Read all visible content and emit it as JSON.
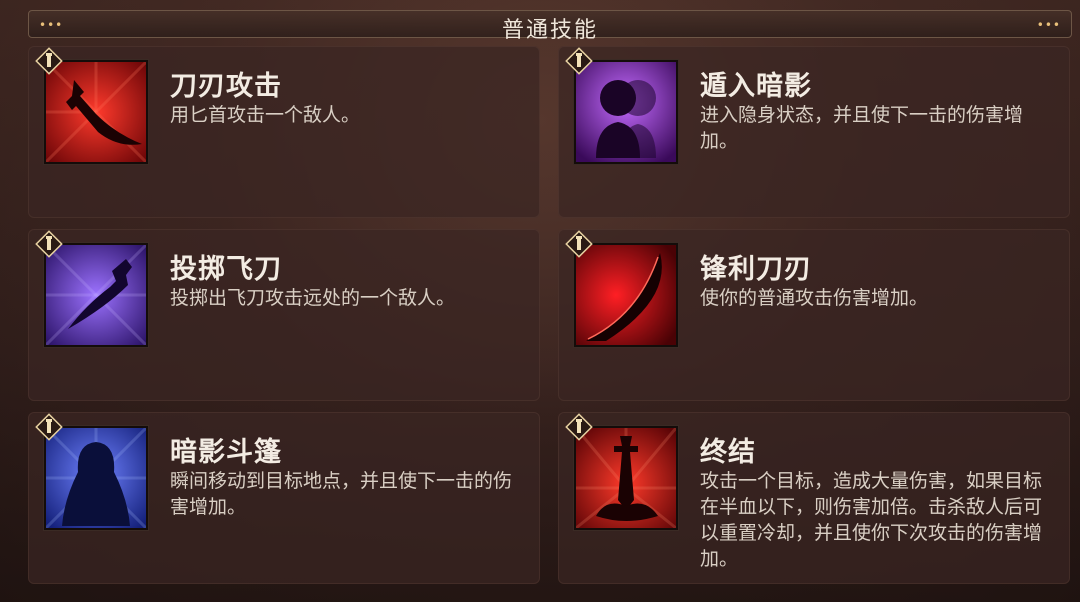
{
  "header": {
    "title": "普通技能",
    "ornament_left": "•••",
    "ornament_right": "•••"
  },
  "skills": [
    {
      "name": "刀刃攻击",
      "desc": "用匕首攻击一个敌人。",
      "icon": "dagger-icon",
      "color": "#c3161a"
    },
    {
      "name": "遁入暗影",
      "desc": "进入隐身状态，并且使下一击的伤害增加。",
      "icon": "shadow-figure-icon",
      "color": "#7a2bb8"
    },
    {
      "name": "投掷飞刀",
      "desc": "投掷出飞刀攻击远处的一个敌人。",
      "icon": "throwing-knife-icon",
      "color": "#6a3ee0"
    },
    {
      "name": "锋利刀刃",
      "desc": "使你的普通攻击伤害增加。",
      "icon": "sharp-blade-icon",
      "color": "#c00d12"
    },
    {
      "name": "暗影斗篷",
      "desc": "瞬间移动到目标地点，并且使下一击的伤害增加。",
      "icon": "hooded-cloak-icon",
      "color": "#3b4ee8"
    },
    {
      "name": "终结",
      "desc": "攻击一个目标，造成大量伤害，如果目标在半血以下，则伤害加倍。击杀敌人后可以重置冷却，并且使你下次攻击的伤害增加。",
      "icon": "finisher-stab-icon",
      "color": "#b8141a"
    }
  ]
}
